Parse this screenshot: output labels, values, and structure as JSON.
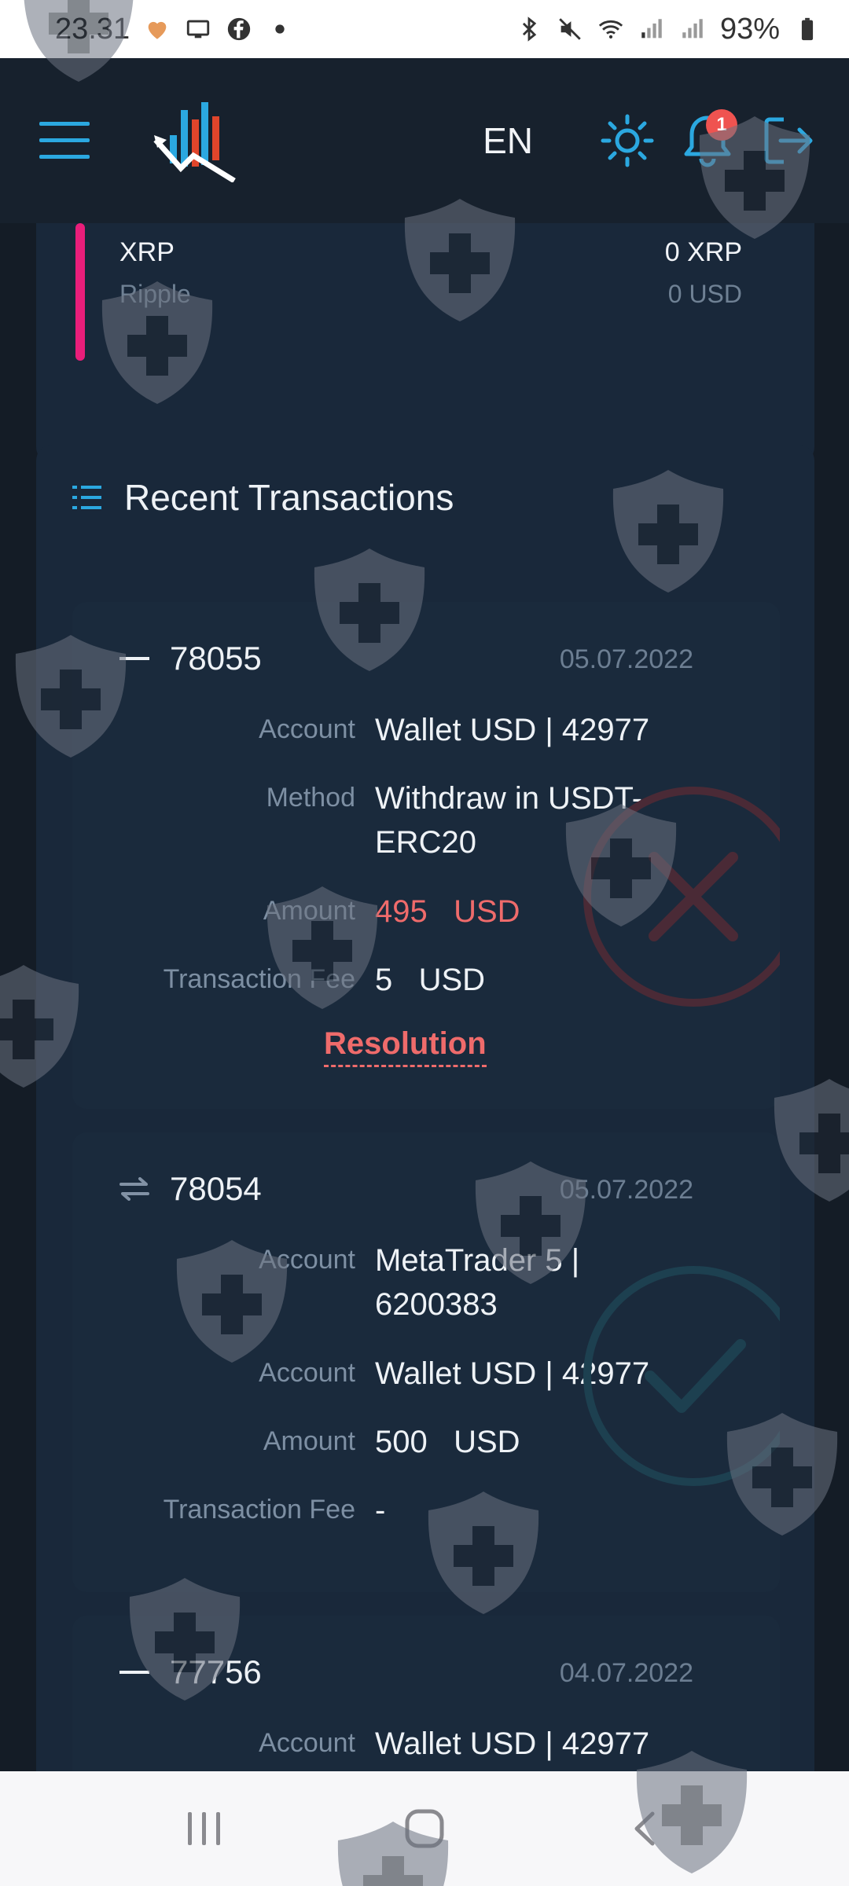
{
  "status_bar": {
    "time": "23.31",
    "battery": "93%"
  },
  "header": {
    "language": "EN",
    "notification_count": "1"
  },
  "xrp_balance": {
    "symbol": "XRP",
    "name": "Ripple",
    "amount": "0 XRP",
    "usd": "0 USD"
  },
  "recent": {
    "title": "Recent Transactions",
    "transactions": [
      {
        "id": "78055",
        "date": "05.07.2022",
        "type": "withdraw",
        "status": "rejected",
        "account_label": "Account",
        "account": "Wallet USD | 42977",
        "method_label": "Method",
        "method": "Withdraw in USDT-ERC20",
        "amount_label": "Amount",
        "amount": "495   USD",
        "fee_label": "Transaction Fee",
        "fee": "5   USD",
        "resolution": "Resolution"
      },
      {
        "id": "78054",
        "date": "05.07.2022",
        "type": "transfer",
        "status": "completed",
        "from_label": "Account",
        "from": "MetaTrader 5 | 6200383",
        "to_label": "Account",
        "to": "Wallet USD | 42977",
        "amount_label": "Amount",
        "amount": "500   USD",
        "fee_label": "Transaction Fee",
        "fee": "-"
      },
      {
        "id": "77756",
        "date": "04.07.2022",
        "type": "withdraw",
        "account_label": "Account",
        "account": "Wallet USD | 42977"
      }
    ]
  },
  "colors": {
    "accent": "#2ba8e0",
    "danger": "#ef6b6b",
    "card": "#19283a",
    "background": "#141c26"
  }
}
